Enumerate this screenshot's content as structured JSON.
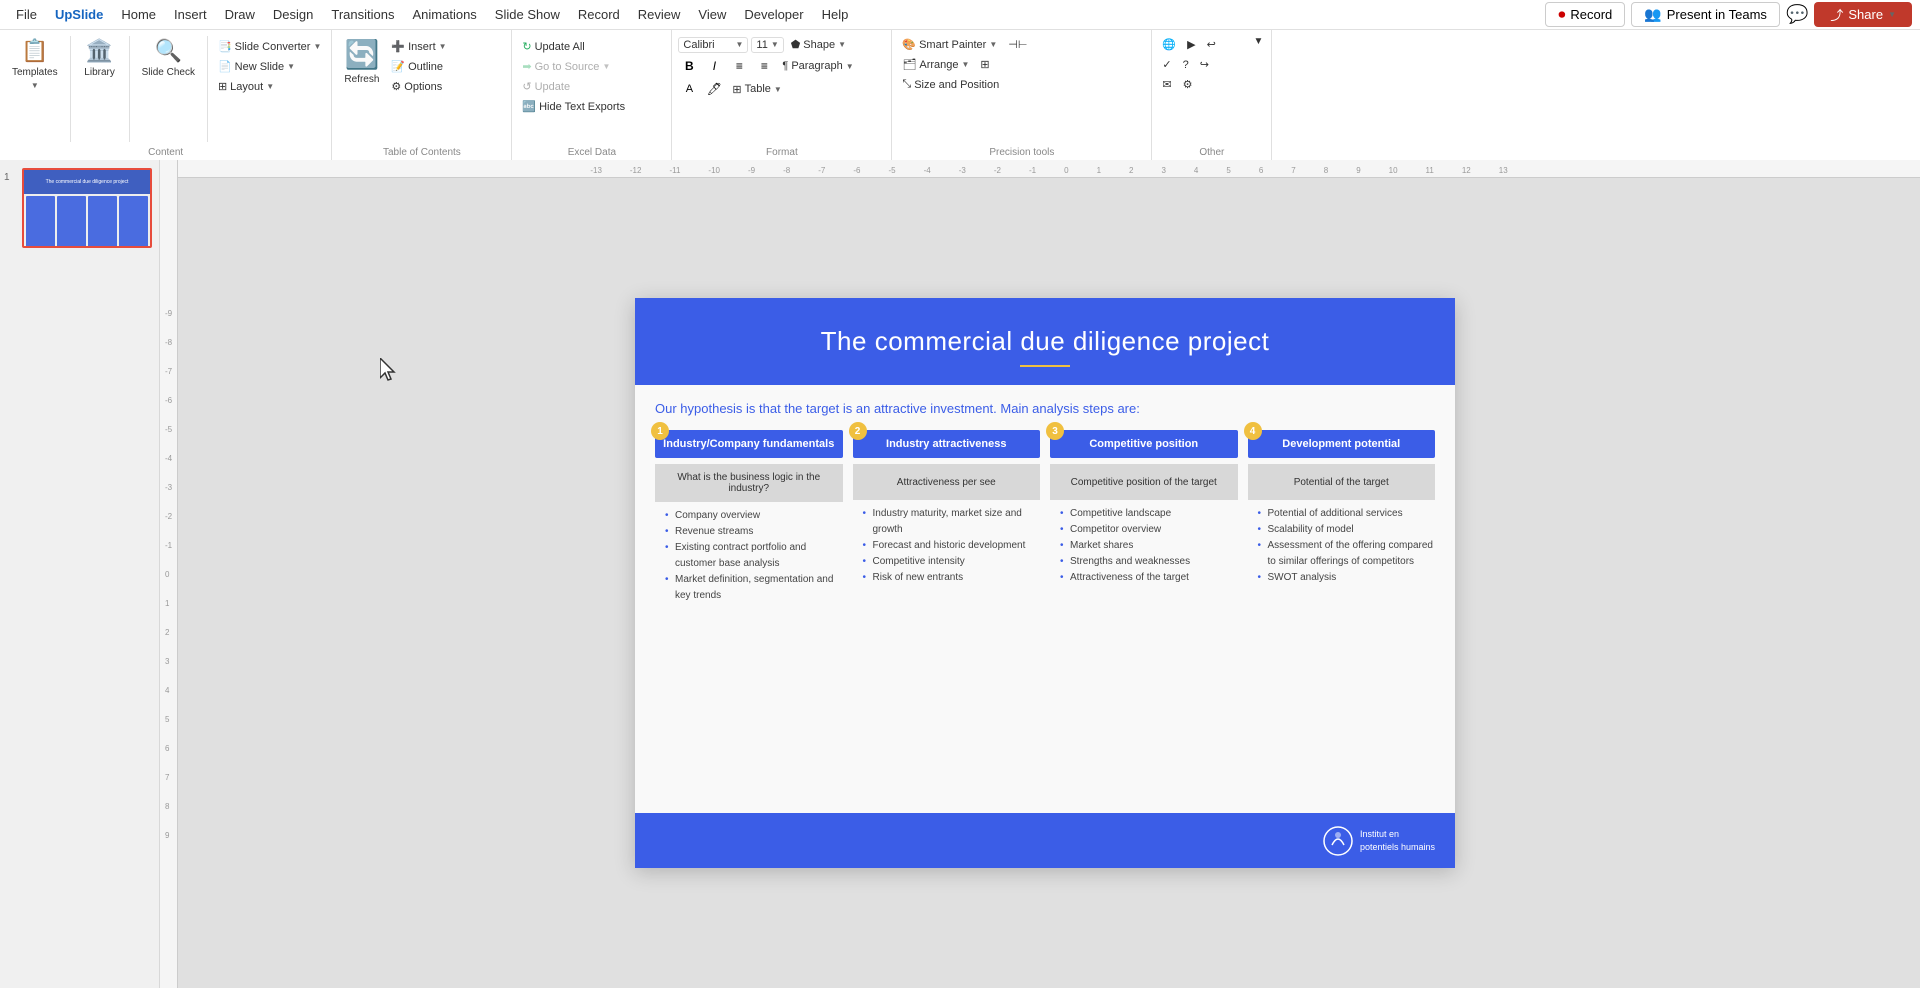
{
  "app": {
    "name": "UpSlide",
    "menu": [
      "File",
      "Home",
      "Insert",
      "Draw",
      "Design",
      "Transitions",
      "Animations",
      "Slide Show",
      "Record",
      "Review",
      "View",
      "Developer",
      "Help"
    ]
  },
  "topbar": {
    "record_label": "Record",
    "present_label": "Present in Teams",
    "share_label": "Share",
    "chat_icon": "💬"
  },
  "ribbon": {
    "content_group": {
      "label": "Content",
      "templates_label": "Templates",
      "library_label": "Library",
      "slide_check_label": "Slide Check",
      "slide_converter_label": "Slide Converter",
      "new_slide_label": "New Slide",
      "layout_label": "Layout"
    },
    "toc_group": {
      "label": "Table of Contents",
      "insert_label": "Insert",
      "outline_label": "Outline",
      "options_label": "Options",
      "refresh_label": "Refresh"
    },
    "excel_group": {
      "label": "Excel Data",
      "update_all_label": "Update All",
      "go_to_source_label": "Go to Source",
      "update_label": "Update",
      "hide_text_exports_label": "Hide Text Exports"
    },
    "format_group": {
      "label": "Format",
      "shape_label": "Shape",
      "paragraph_label": "Paragraph",
      "table_label": "Table"
    },
    "precision_group": {
      "label": "Precision tools",
      "smart_painter_label": "Smart Painter",
      "arrange_label": "Arrange",
      "size_position_label": "Size and Position"
    },
    "other_group": {
      "label": "Other"
    }
  },
  "slide": {
    "title": "The commercial due diligence project",
    "hypothesis": "Our hypothesis is that the target is an attractive investment. Main analysis steps are:",
    "columns": [
      {
        "num": "1",
        "header": "Industry/Company fundamentals",
        "subheader": "What is the business logic in the industry?",
        "items": [
          "Company overview",
          "Revenue streams",
          "Existing contract portfolio and customer base analysis",
          "Market definition, segmentation and key trends"
        ]
      },
      {
        "num": "2",
        "header": "Industry attractiveness",
        "subheader": "Attractiveness per see",
        "items": [
          "Industry maturity, market size and growth",
          "Forecast and historic development",
          "Competitive intensity",
          "Risk of new entrants"
        ]
      },
      {
        "num": "3",
        "header": "Competitive position",
        "subheader": "Competitive position of the target",
        "items": [
          "Competitive landscape",
          "Competitor overview",
          "Market shares",
          "Strengths and weaknesses",
          "Attractiveness of the target"
        ]
      },
      {
        "num": "4",
        "header": "Development potential",
        "subheader": "Potential of the target",
        "items": [
          "Potential of additional services",
          "Scalability of model",
          "Assessment of the offering compared to similar offerings of competitors",
          "SWOT analysis"
        ]
      }
    ]
  },
  "ruler": {
    "top_marks": [
      "-13",
      "-12",
      "-11",
      "-10",
      "-9",
      "-8",
      "-7",
      "-6",
      "-5",
      "-4",
      "-3",
      "-2",
      "-1",
      "0",
      "1",
      "2",
      "3",
      "4",
      "5",
      "6",
      "7",
      "8",
      "9",
      "10",
      "11",
      "12",
      "13"
    ],
    "side_marks": [
      "-9",
      "-8",
      "-7",
      "-6",
      "-5",
      "-4",
      "-3",
      "-2",
      "-1",
      "0",
      "1",
      "2",
      "3",
      "4",
      "5",
      "6",
      "7",
      "8",
      "9"
    ]
  }
}
